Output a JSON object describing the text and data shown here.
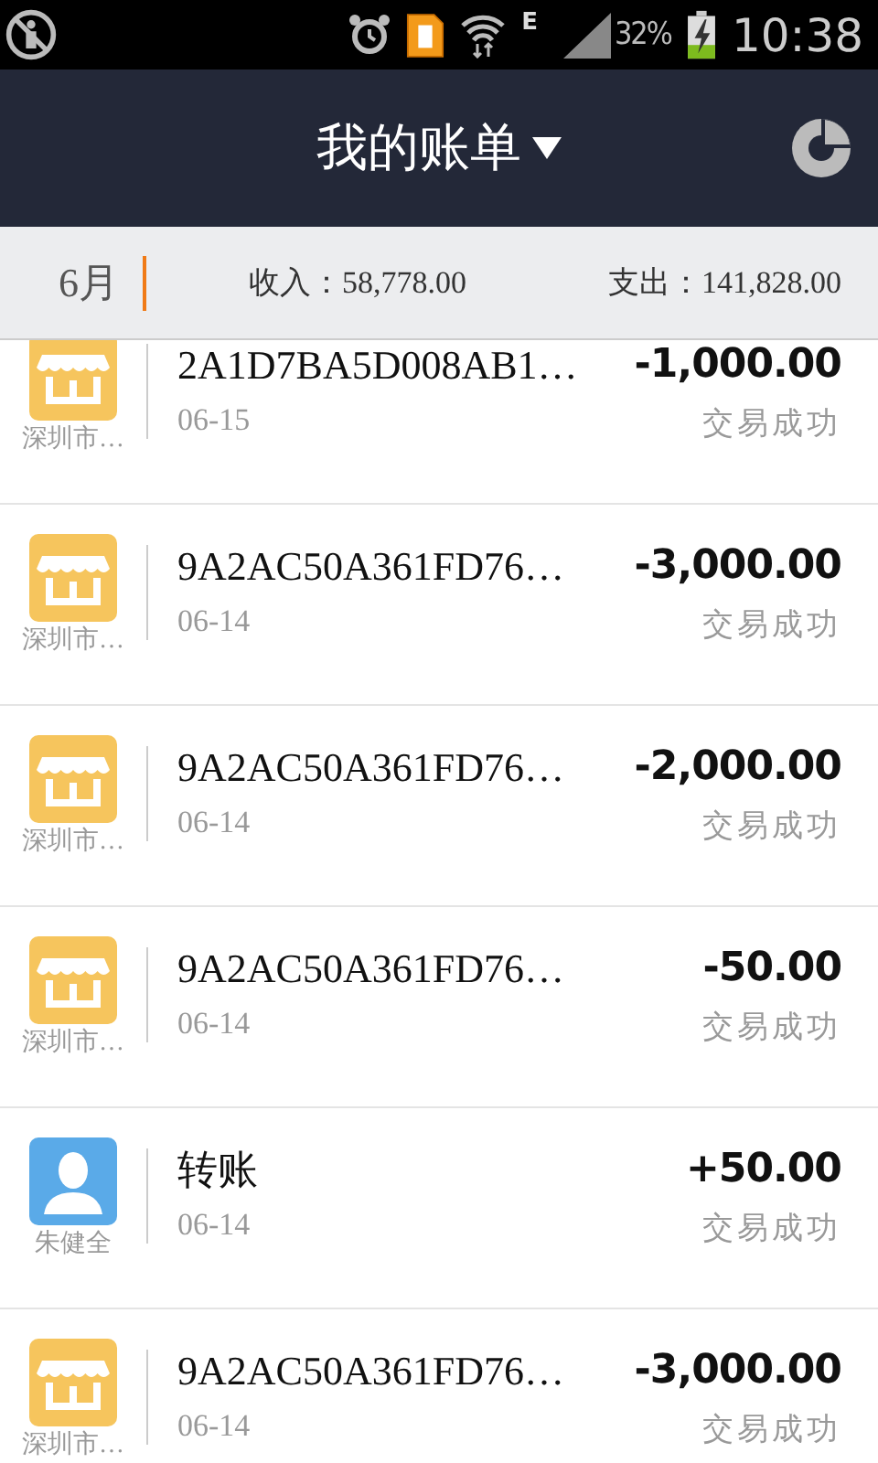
{
  "status_bar": {
    "network": "E",
    "battery": "32%",
    "time": "10:38"
  },
  "header": {
    "title": "我的账单"
  },
  "summary": {
    "month": "6月",
    "income": "收入：58,778.00",
    "expense": "支出：141,828.00"
  },
  "transactions": [
    {
      "kind": "shop",
      "name": "深圳市…",
      "title": "2A1D7BA5D008AB1…",
      "date": "06-15",
      "amount": "-1,000.00",
      "status": "交易成功"
    },
    {
      "kind": "shop",
      "name": "深圳市…",
      "title": "9A2AC50A361FD76…",
      "date": "06-14",
      "amount": "-3,000.00",
      "status": "交易成功"
    },
    {
      "kind": "shop",
      "name": "深圳市…",
      "title": "9A2AC50A361FD76…",
      "date": "06-14",
      "amount": "-2,000.00",
      "status": "交易成功"
    },
    {
      "kind": "shop",
      "name": "深圳市…",
      "title": "9A2AC50A361FD76…",
      "date": "06-14",
      "amount": "-50.00",
      "status": "交易成功"
    },
    {
      "kind": "person",
      "name": "朱健全",
      "title": "转账",
      "date": "06-14",
      "amount": "+50.00",
      "status": "交易成功"
    },
    {
      "kind": "shop",
      "name": "深圳市…",
      "title": "9A2AC50A361FD76…",
      "date": "06-14",
      "amount": "-3,000.00",
      "status": "交易成功"
    }
  ]
}
